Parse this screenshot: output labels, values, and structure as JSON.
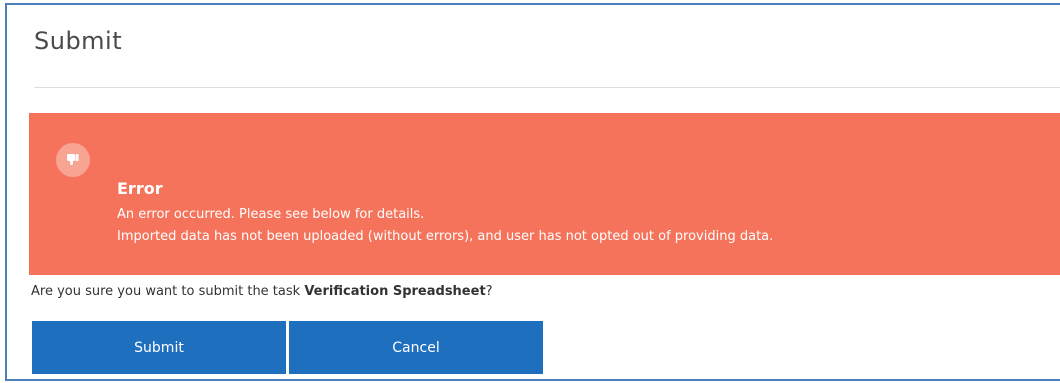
{
  "dialog": {
    "title": "Submit"
  },
  "alert": {
    "icon": "thumbs-down-icon",
    "title": "Error",
    "line1": "An error occurred. Please see below for details.",
    "line2": "Imported data has not been uploaded (without errors), and user has not opted out of providing data.",
    "color": "#f5735a"
  },
  "confirm": {
    "prefix": "Are you sure you want to submit the task ",
    "task_name": "Verification Spreadsheet",
    "suffix": "?"
  },
  "buttons": {
    "submit_label": "Submit",
    "cancel_label": "Cancel",
    "color": "#1f6fbf"
  }
}
